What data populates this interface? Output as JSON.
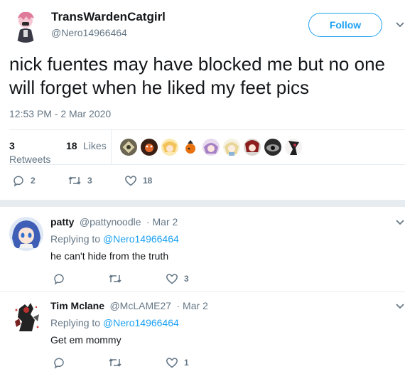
{
  "main_tweet": {
    "author_name": "TransWardenCatgirl",
    "author_handle": "@Nero14966464",
    "follow_label": "Follow",
    "text": "nick fuentes may have blocked me but no one will forget when he liked my feet pics",
    "timestamp": "12:53 PM - 2 Mar 2020",
    "retweets_count": "3",
    "retweets_label": "Retweets",
    "likes_count": "18",
    "likes_label": "Likes",
    "actions": {
      "reply_count": "2",
      "retweet_count": "3",
      "like_count": "18"
    },
    "liker_avatar_icons": [
      "liker-avatar-1",
      "liker-avatar-2",
      "liker-avatar-3",
      "liker-avatar-4",
      "liker-avatar-5",
      "liker-avatar-6",
      "liker-avatar-7",
      "liker-avatar-8",
      "liker-avatar-9"
    ]
  },
  "replies": [
    {
      "name": "patty",
      "handle": "@pattynoodle",
      "date": "· Mar 2",
      "replying_prefix": "Replying to",
      "replying_to": "@Nero14966464",
      "text": "he can't hide from the truth",
      "reply_count": "",
      "retweet_count": "",
      "like_count": "3"
    },
    {
      "name": "Tim Mclane",
      "handle": "@McLAME27",
      "date": "· Mar 2",
      "replying_prefix": "Replying to",
      "replying_to": "@Nero14966464",
      "text": "Get em mommy",
      "reply_count": "",
      "retweet_count": "",
      "like_count": "1"
    }
  ],
  "colors": {
    "accent": "#1da1f2",
    "muted": "#657786",
    "divider": "#e6ecf0"
  }
}
